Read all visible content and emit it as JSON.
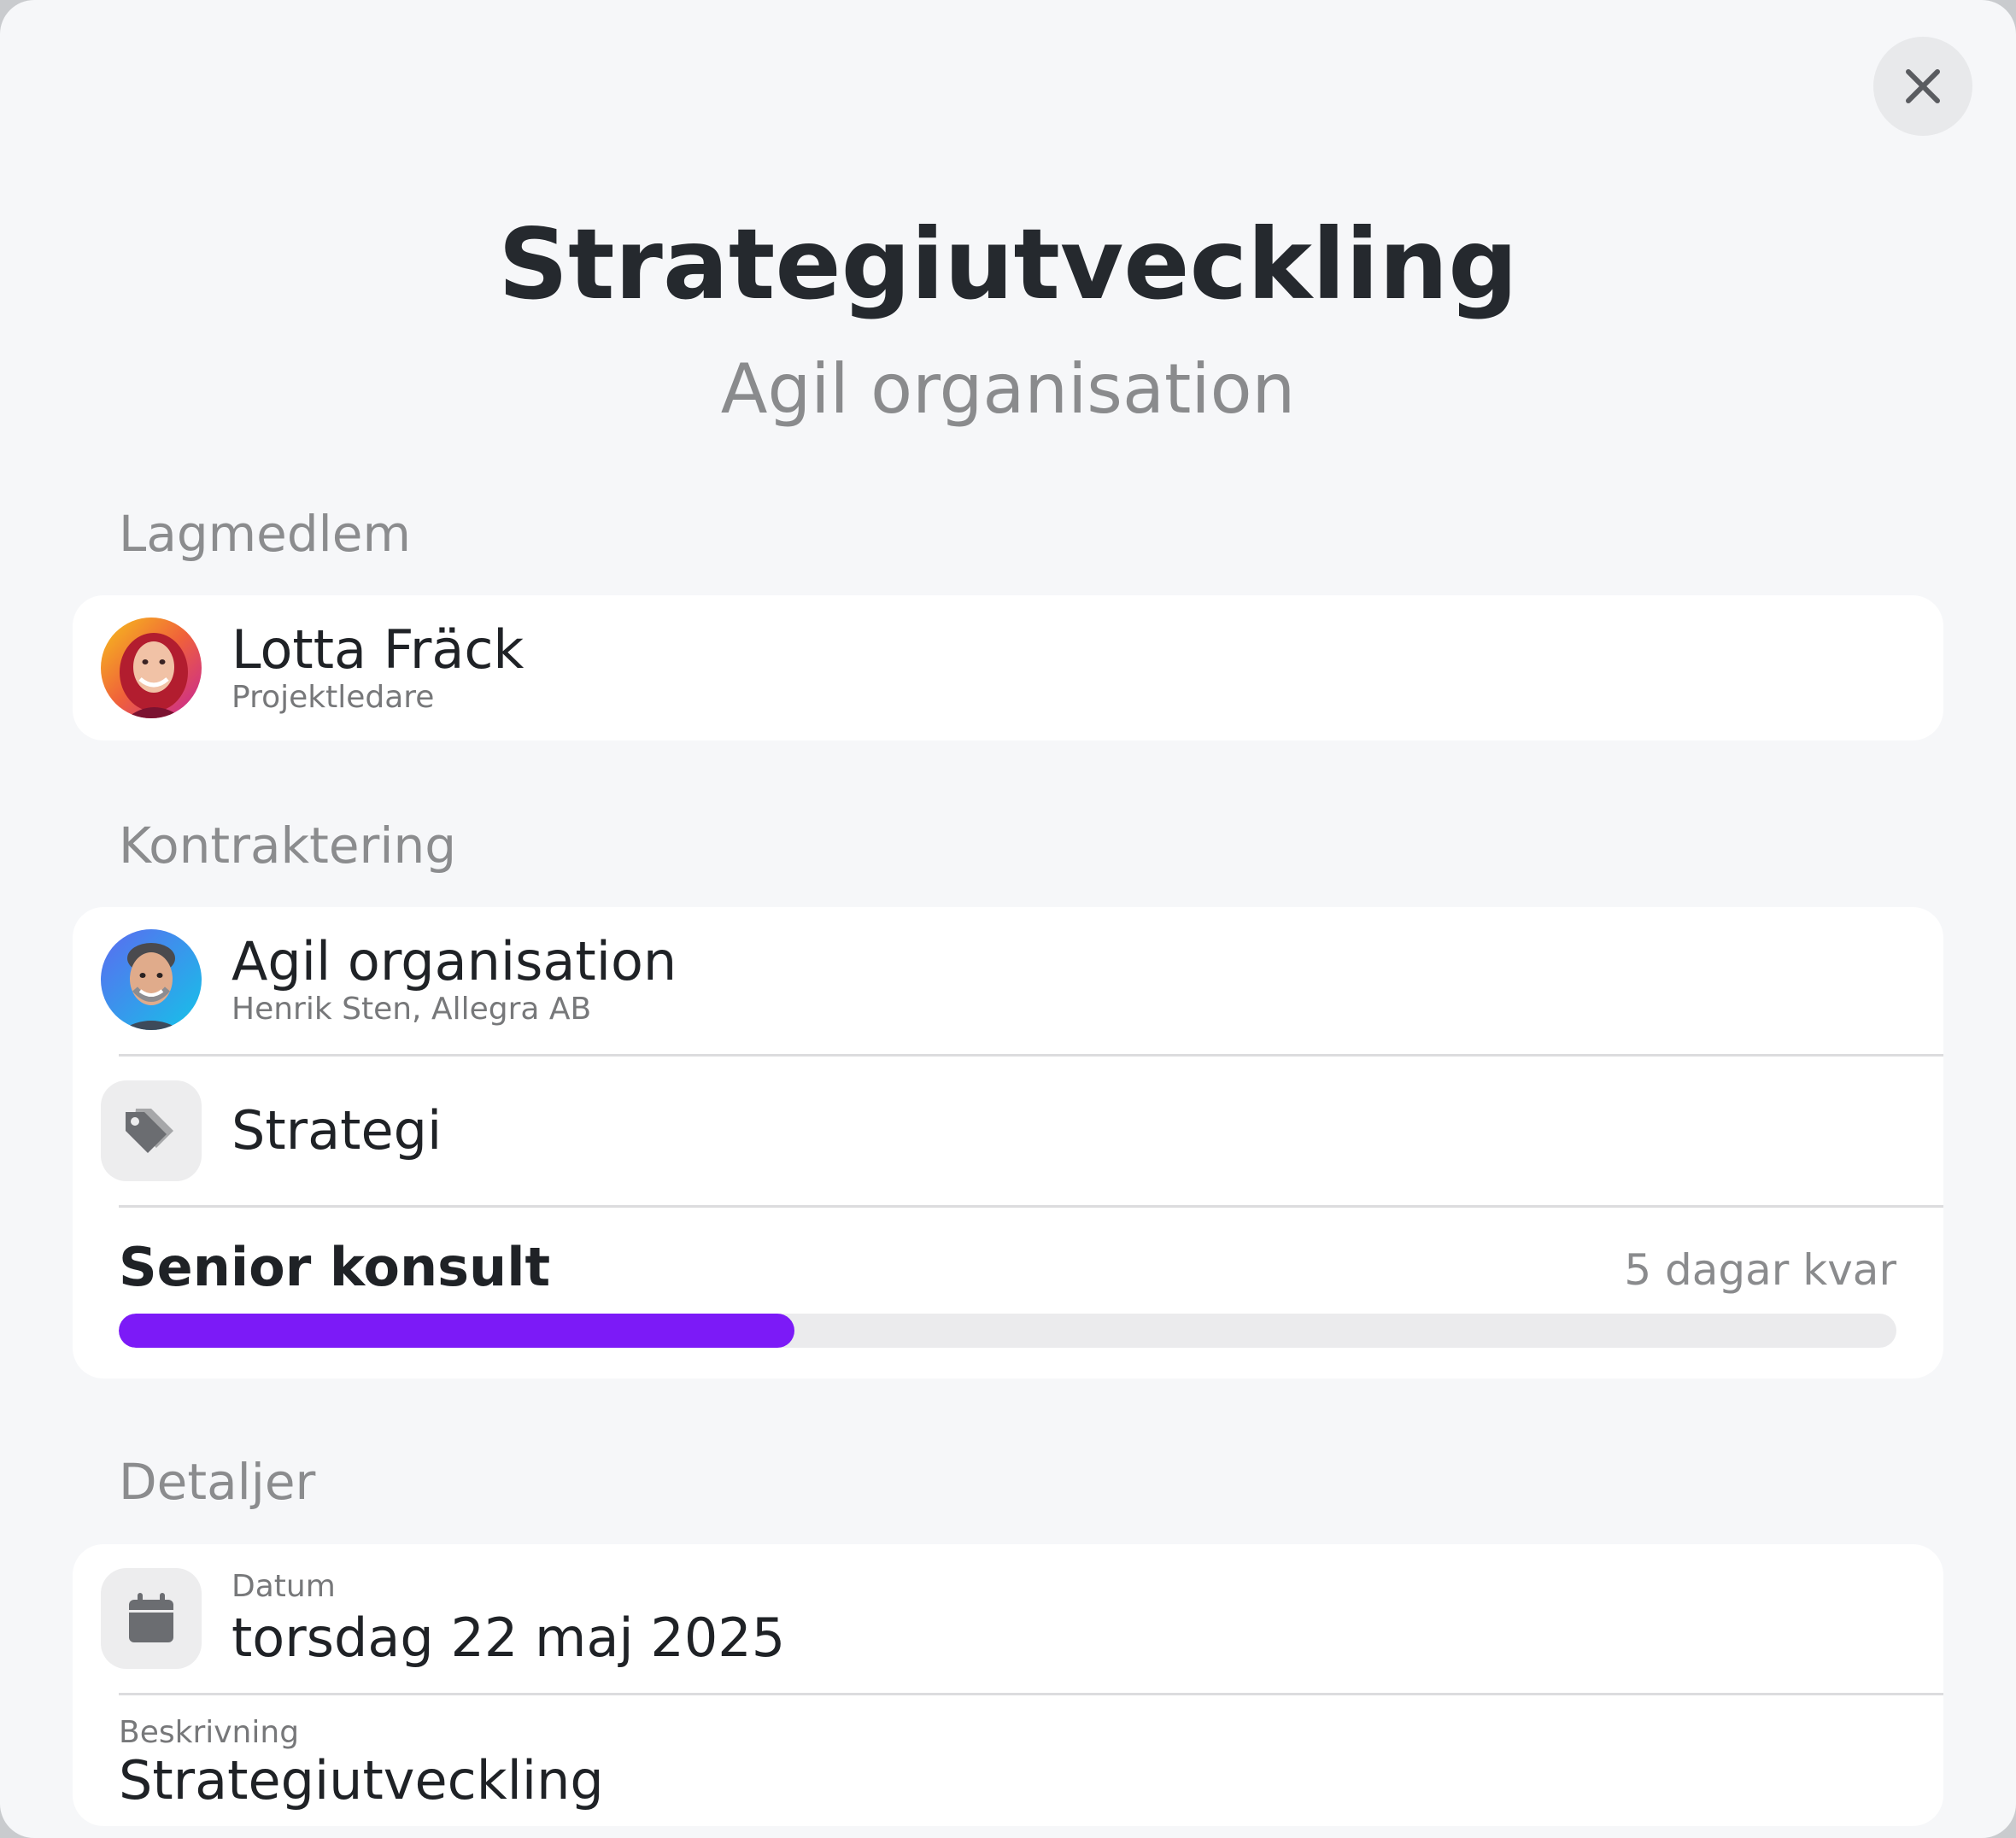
{
  "modal": {
    "title": "Strategiutveckling",
    "subtitle": "Agil organisation",
    "close_icon": "close-icon"
  },
  "sections": {
    "team": {
      "label": "Lagmedlem",
      "member": {
        "name": "Lotta Fräck",
        "role": "Projektledare"
      }
    },
    "contract": {
      "label": "Kontraktering",
      "client": {
        "name": "Agil organisation",
        "contact": "Henrik Sten, Allegra AB"
      },
      "category": {
        "icon": "tag-icon",
        "label": "Strategi"
      },
      "allocation": {
        "role": "Senior konsult",
        "remaining": "5 dagar kvar",
        "progress_fraction": 0.38,
        "bar_color": "#7c1af7"
      }
    },
    "details": {
      "label": "Detaljer",
      "date": {
        "icon": "calendar-icon",
        "label": "Datum",
        "value": "torsdag 22 maj 2025"
      },
      "description": {
        "label": "Beskrivning",
        "value": "Strategiutveckling"
      }
    }
  }
}
